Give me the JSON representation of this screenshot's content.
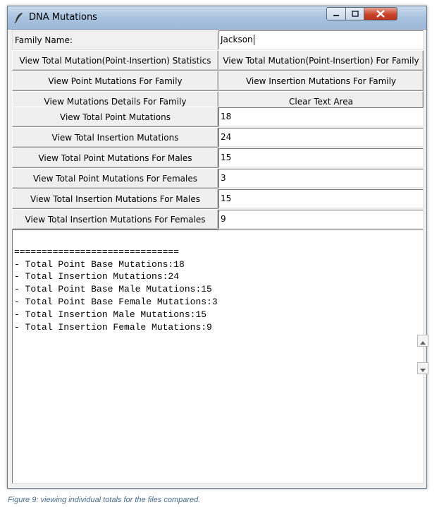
{
  "window": {
    "title": "DNA Mutations",
    "icon": "feather-icon",
    "controls": {
      "minimize": "minimize-icon",
      "maximize": "maximize-icon",
      "close": "close-icon"
    }
  },
  "family_row": {
    "label": "Family Name:",
    "value": "Jackson"
  },
  "action_buttons": [
    {
      "left": "View Total Mutation(Point-Insertion) Statistics",
      "right": "View Total Mutation(Point-Insertion) For Family"
    },
    {
      "left": "View Point Mutations For Family",
      "right": "View Insertion Mutations For Family"
    },
    {
      "left": "View Mutations Details For Family",
      "right": "Clear Text Area"
    }
  ],
  "stat_rows": [
    {
      "button": "View Total Point Mutations",
      "value": "18"
    },
    {
      "button": "View Total Insertion Mutations",
      "value": "24"
    },
    {
      "button": "View Total Point Mutations For Males",
      "value": "15"
    },
    {
      "button": "View Total Point Mutations For Females",
      "value": "3"
    },
    {
      "button": "View Total Insertion Mutations For Males",
      "value": "15"
    },
    {
      "button": "View Total Insertion Mutations For Females",
      "value": "9"
    }
  ],
  "text_area": {
    "lines": [
      "==============================",
      "- Total Point Base Mutations:18",
      "- Total Insertion Mutations:24",
      "- Total Point Base Male Mutations:15",
      "- Total Point Base Female Mutations:3",
      "- Total Insertion Male Mutations:15",
      "- Total Insertion Female Mutations:9"
    ]
  },
  "caption": "Figure 9: viewing individual totals for the files compared.",
  "colors": {
    "titlebar": "#a9c3df",
    "close_button": "#c9442b",
    "caption": "#4a6d8f"
  }
}
